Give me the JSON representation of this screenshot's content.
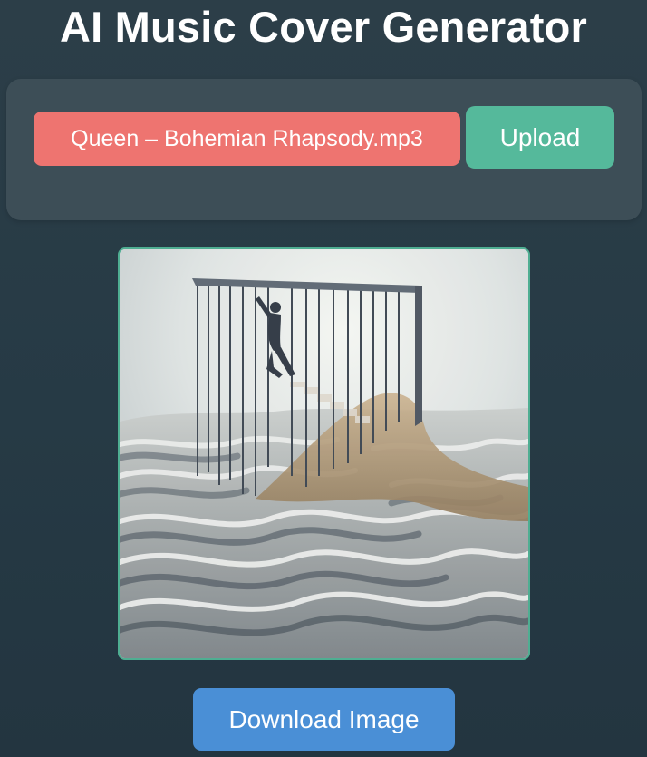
{
  "app": {
    "title": "AI Music Cover Generator"
  },
  "upload": {
    "file_name": "Queen – Bohemian Rhapsody.mp3",
    "button_label": "Upload"
  },
  "cover": {
    "image_name": "generated-cover-image"
  },
  "download": {
    "button_label": "Download Image"
  },
  "colors": {
    "background": "#263a45",
    "panel": "#3d4e57",
    "file_field": "#ee7470",
    "upload_button": "#55b99b",
    "download_button": "#4a8fd6",
    "image_border": "#4fae92"
  }
}
